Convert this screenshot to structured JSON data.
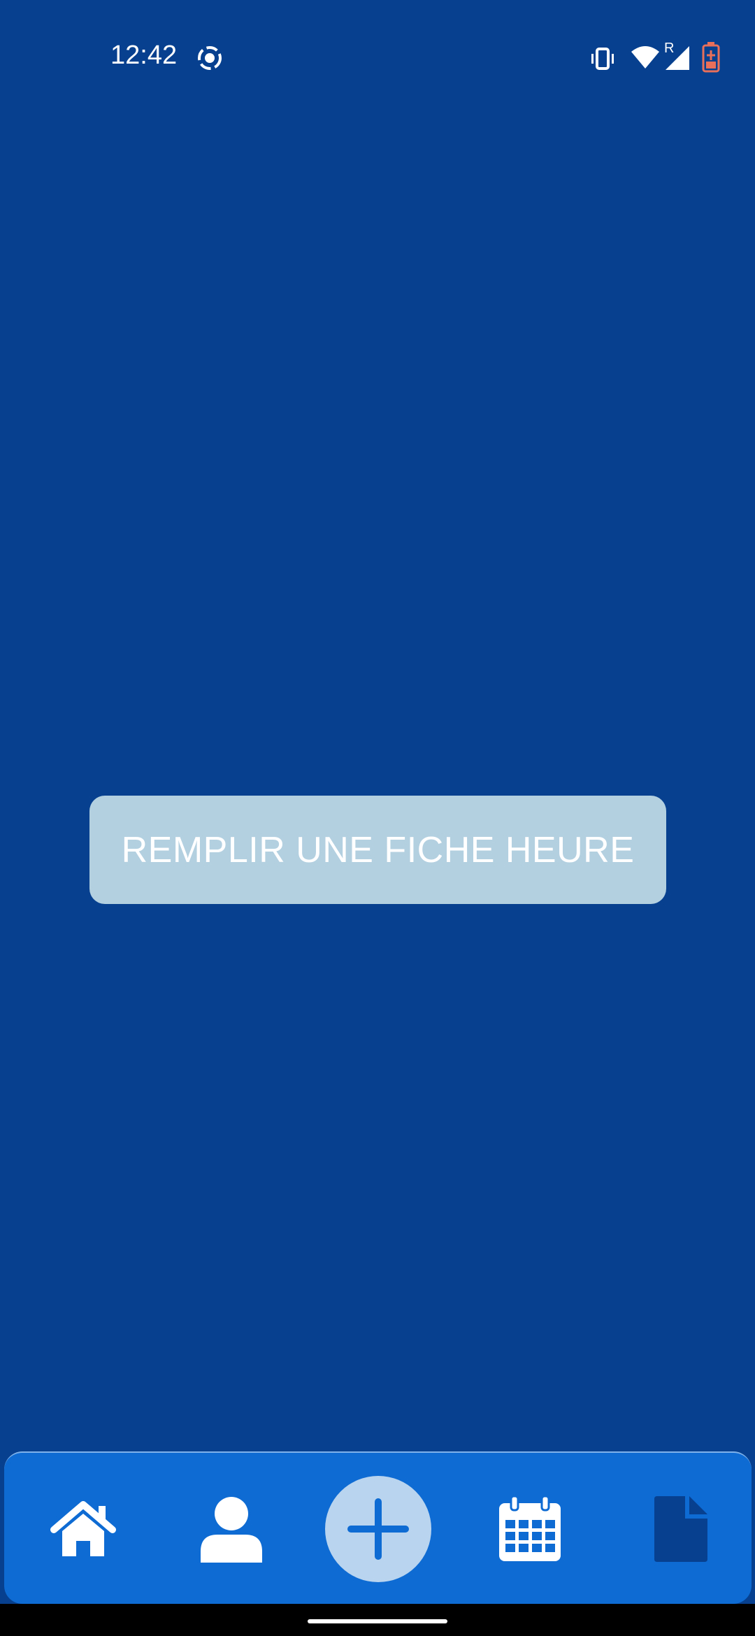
{
  "status_bar": {
    "time": "12:42",
    "icons": [
      "screen-record-icon",
      "vibrate-icon",
      "wifi-icon",
      "cell-signal-icon",
      "battery-icon"
    ],
    "roaming_indicator": "R"
  },
  "main": {
    "button_label": "REMPLIR UNE FICHE HEURE"
  },
  "bottom_nav": {
    "items": [
      {
        "icon": "home-icon"
      },
      {
        "icon": "user-icon"
      },
      {
        "icon": "plus-icon"
      },
      {
        "icon": "calendar-icon"
      },
      {
        "icon": "document-icon"
      }
    ]
  },
  "colors": {
    "background": "#06408f",
    "button": "#b3d0e1",
    "nav_bar": "#0d6bd3",
    "fab": "#b9d4ef",
    "battery_accent": "#e8705a"
  }
}
